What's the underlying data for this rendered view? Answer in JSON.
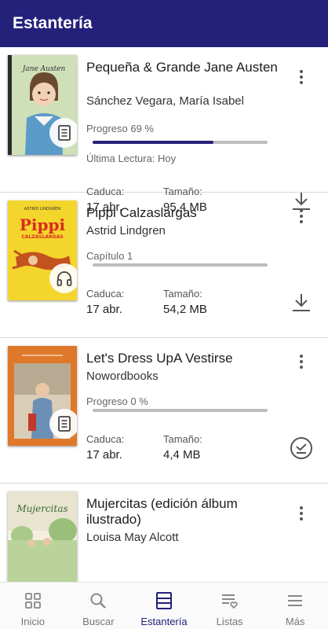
{
  "header": {
    "title": "Estantería"
  },
  "books": [
    {
      "title": "Pequeña & Grande Jane Austen",
      "author": "Sánchez Vegara, María Isabel",
      "status": "Progreso 69 %",
      "progress": 0.69,
      "last_read": "Última Lectura: Hoy",
      "expires_label": "Caduca:",
      "expires": "17 abr.",
      "size_label": "Tamaño:",
      "size": "95,4 MB",
      "format": "document",
      "action": "download-icon",
      "cover_title": "Jane Austen"
    },
    {
      "title": "Pippi Calzaslargas",
      "author": "Astrid Lindgren",
      "status": "Capítulo 1",
      "progress": 0,
      "expires_label": "Caduca:",
      "expires": "17 abr.",
      "size_label": "Tamaño:",
      "size": "54,2 MB",
      "format": "audiobook",
      "action": "download-icon",
      "cover_title": "Pippi",
      "cover_subtitle": "CALZASLARGAS",
      "cover_author": "ASTRID LINDGREN"
    },
    {
      "title": "Let's Dress UpA Vestirse",
      "author": "Nowordbooks",
      "status": "Progreso 0 %",
      "progress": 0,
      "expires_label": "Caduca:",
      "expires": "17 abr.",
      "size_label": "Tamaño:",
      "size": "4,4 MB",
      "format": "document",
      "action": "downloaded-check-icon"
    },
    {
      "title": "Mujercitas (edición álbum ilustrado)",
      "author": "Louisa May Alcott",
      "format": "document",
      "cover_title": "Mujercitas"
    }
  ],
  "nav": [
    {
      "label": "Inicio",
      "icon": "grid-icon",
      "active": false
    },
    {
      "label": "Buscar",
      "icon": "search-icon",
      "active": false
    },
    {
      "label": "Estantería",
      "icon": "shelf-icon",
      "active": true
    },
    {
      "label": "Listas",
      "icon": "list-heart-icon",
      "active": false
    },
    {
      "label": "Más",
      "icon": "menu-icon",
      "active": false
    }
  ],
  "colors": {
    "primary": "#23217a",
    "progress_track": "#bdbdbd",
    "nav_inactive": "#777777"
  }
}
